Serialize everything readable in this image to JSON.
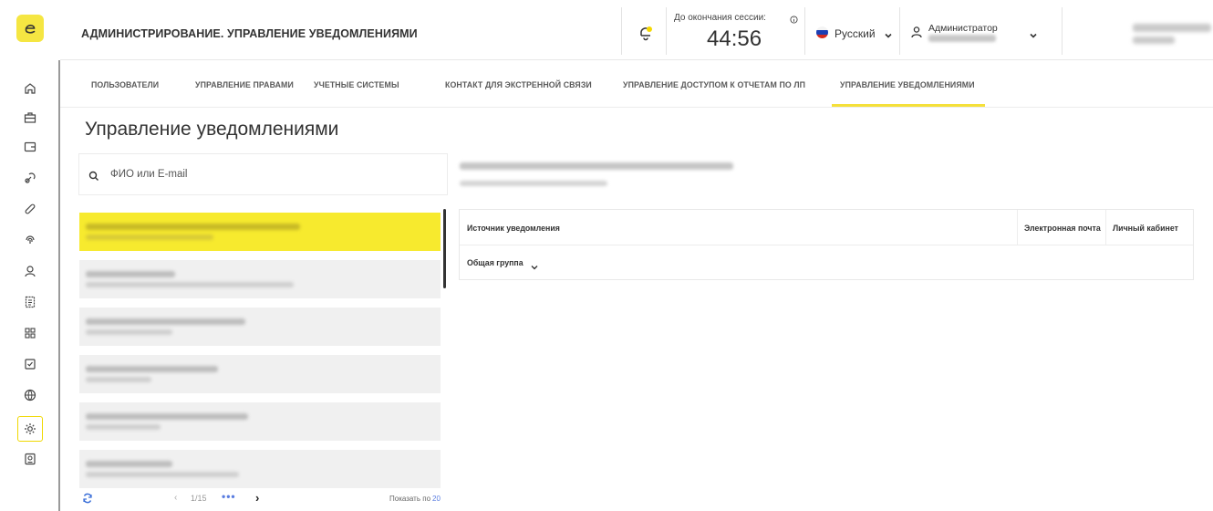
{
  "header": {
    "title": "АДМИНИСТРИРОВАНИЕ. УПРАВЛЕНИЕ УВЕДОМЛЕНИЯМИ",
    "session_label": "До окончания сессии:",
    "session_timer": "44:56",
    "language": "Русский",
    "user_role": "Администратор"
  },
  "tabs": [
    {
      "label": "ПОЛЬЗОВАТЕЛИ"
    },
    {
      "label": "УПРАВЛЕНИЕ ПРАВАМИ"
    },
    {
      "label": "УЧЕТНЫЕ СИСТЕМЫ"
    },
    {
      "label": "КОНТАКТ ДЛЯ ЭКСТРЕННОЙ СВЯЗИ"
    },
    {
      "label": "УПРАВЛЕНИЕ ДОСТУПОМ К ОТЧЕТАМ ПО ЛП"
    },
    {
      "label": "УПРАВЛЕНИЕ УВЕДОМЛЕНИЯМИ",
      "active": true
    }
  ],
  "page": {
    "title": "Управление уведомлениями"
  },
  "search": {
    "placeholder": "ФИО или E-mail"
  },
  "pager": {
    "page": "1/15",
    "dots": "•••",
    "show_label": "Показать по",
    "page_size": "20"
  },
  "table": {
    "col_source": "Источник уведомления",
    "col_email": "Электронная почта",
    "col_cabinet": "Личный кабинет",
    "group_label": "Общая группа"
  },
  "colors": {
    "accent": "#f7ea2e",
    "link": "#5a7de0"
  }
}
